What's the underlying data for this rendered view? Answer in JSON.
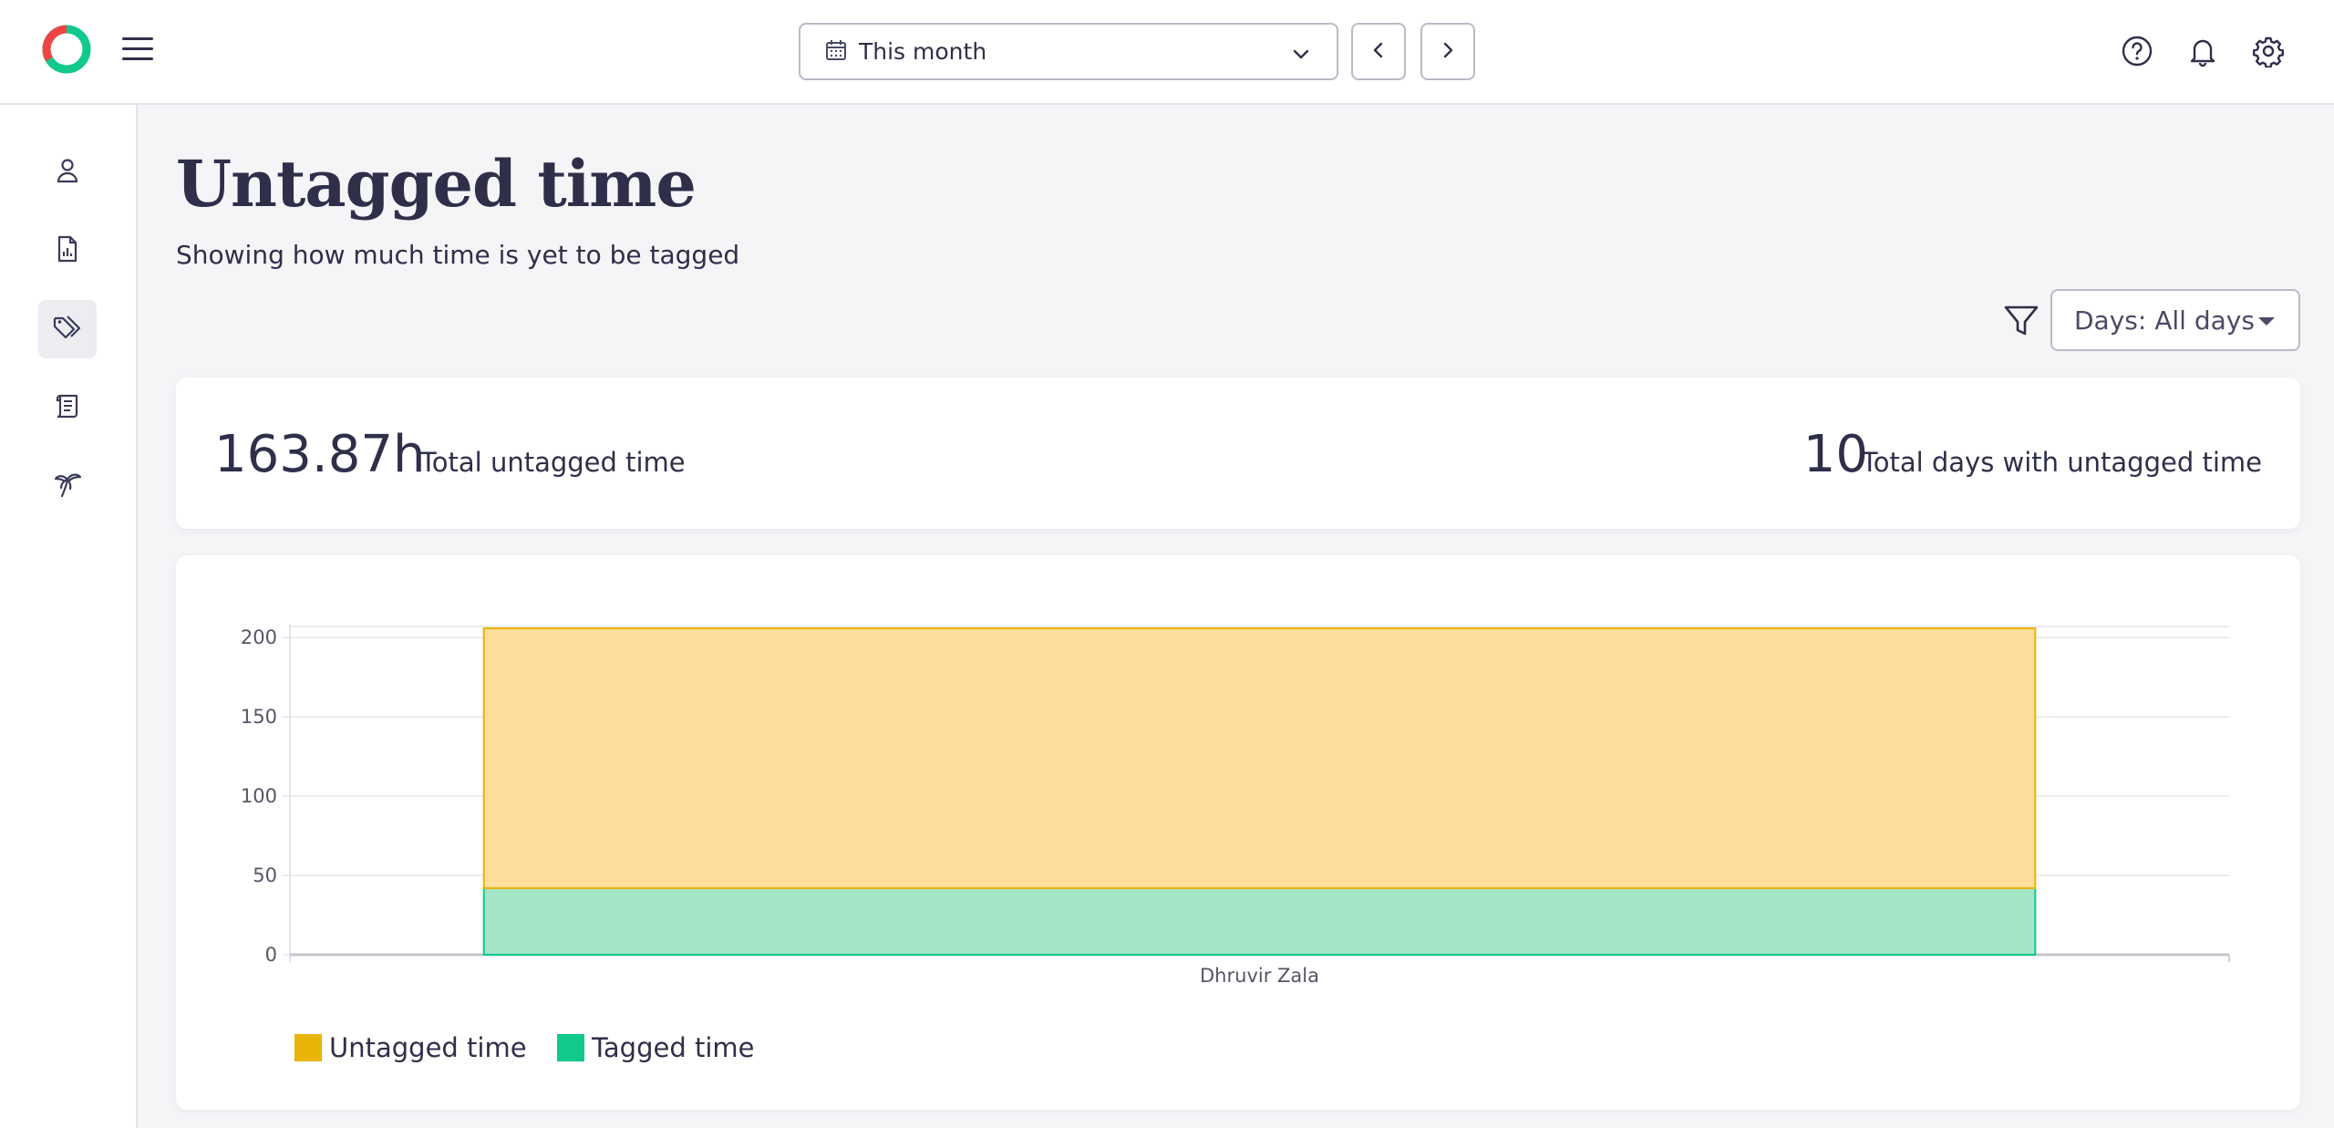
{
  "topbar": {
    "date_range_label": "This month",
    "icons": [
      "logo",
      "menu-icon",
      "calendar-icon",
      "chevron-down-icon",
      "chevron-left-icon",
      "chevron-right-icon",
      "help-icon",
      "bell-icon",
      "gear-icon"
    ]
  },
  "sidebar": {
    "items": [
      {
        "icon": "user-icon",
        "active": false
      },
      {
        "icon": "report-icon",
        "active": false
      },
      {
        "icon": "tags-icon",
        "active": true
      },
      {
        "icon": "scroll-icon",
        "active": false
      },
      {
        "icon": "palm-tree-icon",
        "active": false
      }
    ]
  },
  "header": {
    "title": "Untagged time",
    "subtitle": "Showing how much time is yet to be tagged"
  },
  "filter": {
    "days_label": "Days: All days"
  },
  "summary": {
    "total_untagged_value": "163.87h",
    "total_untagged_label": "Total untagged time",
    "days_value": "10",
    "days_label": "Total days with untagged time"
  },
  "colors": {
    "untagged": "#eab308",
    "untagged_fill": "#fdde9a",
    "tagged": "#10c98b",
    "tagged_fill": "#a3e5c6",
    "text": "#2f2f4a"
  },
  "chart_data": {
    "type": "bar",
    "stacked": true,
    "categories": [
      "Dhruvir Zala"
    ],
    "series": [
      {
        "name": "Tagged time",
        "values": [
          42
        ]
      },
      {
        "name": "Untagged time",
        "values": [
          163.87
        ]
      }
    ],
    "y_ticks": [
      0,
      50,
      100,
      150,
      200
    ],
    "ylim": [
      0,
      205.87
    ],
    "grid": true,
    "legend_position": "bottom-left"
  }
}
